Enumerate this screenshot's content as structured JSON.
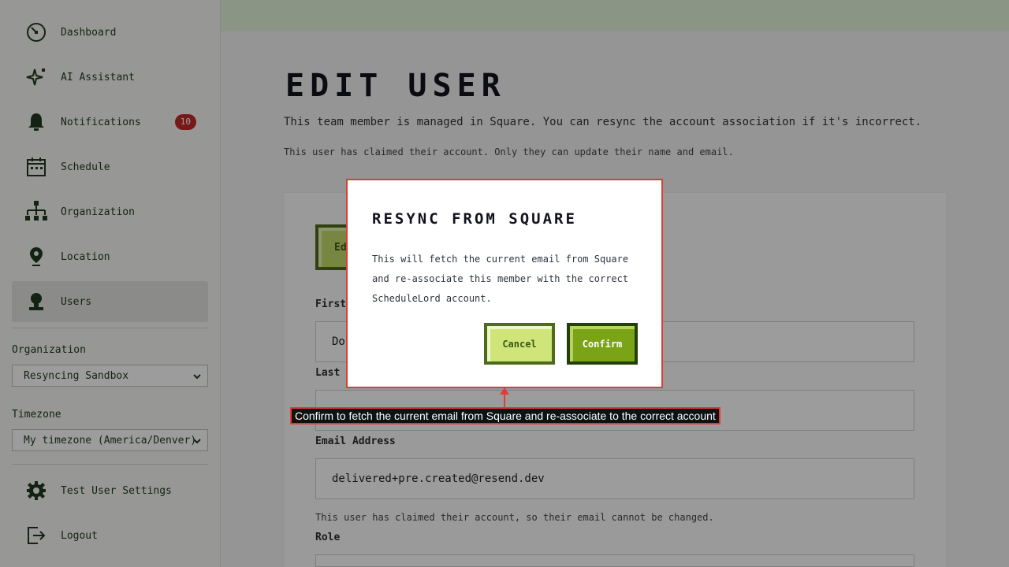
{
  "sidebar": {
    "items": [
      {
        "label": "Dashboard",
        "icon": "dashboard-gauge-icon"
      },
      {
        "label": "AI Assistant",
        "icon": "sparkle-icon"
      },
      {
        "label": "Notifications",
        "icon": "bell-icon",
        "badge": "10"
      },
      {
        "label": "Schedule",
        "icon": "calendar-icon"
      },
      {
        "label": "Organization",
        "icon": "org-chart-icon"
      },
      {
        "label": "Location",
        "icon": "map-pin-icon"
      },
      {
        "label": "Users",
        "icon": "user-icon",
        "active": true
      }
    ],
    "organization_label": "Organization",
    "organization_value": "Resyncing Sandbox",
    "timezone_label": "Timezone",
    "timezone_value": "My timezone (America/Denver)",
    "bottom_items": [
      {
        "label": "Test User Settings",
        "icon": "gear-icon"
      },
      {
        "label": "Logout",
        "icon": "logout-icon"
      }
    ]
  },
  "main": {
    "title": "EDIT USER",
    "description": "This team member is managed in Square. You can resync the account association if it's incorrect.",
    "claimed_note": "This user has claimed their account. Only they can update their name and email.",
    "edit_button_label": "Ed",
    "first_name_label": "First",
    "first_name_value": "Do",
    "last_name_label": "Last r",
    "email_label": "Email Address",
    "email_value": "delivered+pre.created@resend.dev",
    "email_help": "This user has claimed their account, so their email cannot be changed.",
    "role_label": "Role"
  },
  "modal": {
    "title": "RESYNC FROM SQUARE",
    "body": "This will fetch the current email from Square and re-associate this member with the correct ScheduleLord account.",
    "cancel_label": "Cancel",
    "confirm_label": "Confirm"
  },
  "tooltip": {
    "text": "Confirm to fetch the current email from Square and re-associate to the correct account"
  },
  "colors": {
    "accent_green": "#7aa317",
    "dark_green": "#1f3a1f",
    "highlight_red": "#e53935",
    "badge_red": "#c62828"
  }
}
